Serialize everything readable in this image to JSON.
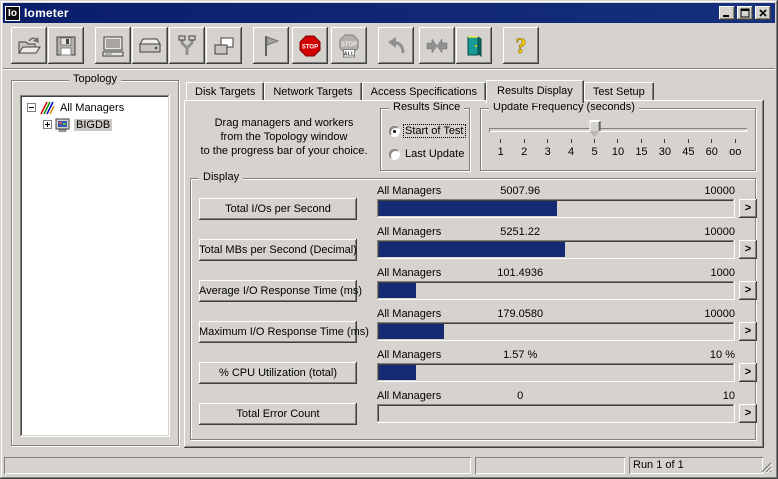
{
  "window": {
    "logo": "Io",
    "title": "Iometer"
  },
  "titlebar": {
    "buttons": [
      "minimize-icon",
      "maximize-icon",
      "close-icon"
    ]
  },
  "toolbar": {
    "buttons": [
      "open-icon",
      "save-icon",
      "new-manager-icon",
      "new-disk-worker-icon",
      "new-network-worker-icon",
      "duplicate-worker-icon",
      "start-tests-flag-icon",
      "stop-test-icon",
      "stop-all-tests-icon",
      "reset-workers-icon",
      "move-workers-icon",
      "exit-door-icon",
      "help-icon"
    ],
    "stop_sign_text": "STOP",
    "stop_all_text": "ALL",
    "help_glyph": "?"
  },
  "topology": {
    "caption": "Topology",
    "tree": [
      {
        "label": "All Managers",
        "expander": "minus",
        "icon": "all-managers-icon",
        "level": 0,
        "selected": false
      },
      {
        "label": "BIGDB",
        "expander": "plus",
        "icon": "manager-computer-icon",
        "level": 1,
        "selected": true
      }
    ]
  },
  "tabs": [
    {
      "label": "Disk Targets",
      "active": false
    },
    {
      "label": "Network Targets",
      "active": false
    },
    {
      "label": "Access Specifications",
      "active": false
    },
    {
      "label": "Results Display",
      "active": true
    },
    {
      "label": "Test Setup",
      "active": false
    }
  ],
  "results_panel": {
    "drag_hint_lines": [
      "Drag managers and workers",
      "from the Topology window",
      "to the progress bar of your choice."
    ],
    "results_since": {
      "caption": "Results Since",
      "options": [
        {
          "label": "Start of Test",
          "selected": true
        },
        {
          "label": "Last Update",
          "selected": false
        }
      ]
    },
    "update_frequency": {
      "caption": "Update Frequency (seconds)",
      "tick_labels": [
        "1",
        "2",
        "3",
        "4",
        "5",
        "10",
        "15",
        "30",
        "45",
        "60",
        "oo"
      ],
      "slider_value_index": 4
    }
  },
  "display": {
    "caption": "Display",
    "more_label": ">",
    "rows": [
      {
        "label": "Total I/Os per Second",
        "scope": "All Managers",
        "value": "5007.96",
        "max": "10000",
        "fill_percent": 50.3
      },
      {
        "label": "Total MBs per Second (Decimal)",
        "scope": "All Managers",
        "value": "5251.22",
        "max": "10000",
        "fill_percent": 52.5
      },
      {
        "label": "Average I/O Response Time (ms)",
        "scope": "All Managers",
        "value": "101.4936",
        "max": "1000",
        "fill_percent": 10.5
      },
      {
        "label": "Maximum I/O Response Time (ms)",
        "scope": "All Managers",
        "value": "179.0580",
        "max": "10000",
        "fill_percent": 18.3
      },
      {
        "label": "% CPU Utilization (total)",
        "scope": "All Managers",
        "value": "1.57 %",
        "max": "10 %",
        "fill_percent": 10.5
      },
      {
        "label": "Total Error Count",
        "scope": "All Managers",
        "value": "0",
        "max": "10",
        "fill_percent": 0
      }
    ]
  },
  "statusbar": {
    "panes": [
      "",
      "",
      "Run 1 of 1"
    ]
  },
  "colors": {
    "titlebar_navy": "#0a1e6b",
    "bar_fill_navy": "#142a72",
    "window_face": "#d6d3ce",
    "stop_red": "#d40000",
    "help_yellow": "#ffd700",
    "door_teal": "#1a9a96"
  }
}
